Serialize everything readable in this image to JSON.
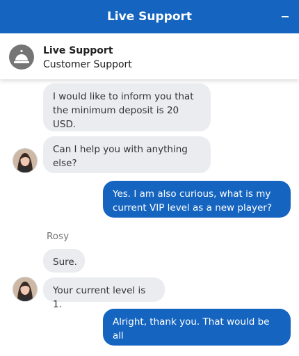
{
  "window": {
    "title": "Live Support",
    "minimize_icon": "minus-icon",
    "accent_color": "#1565c0"
  },
  "agent": {
    "name": "Live Support",
    "role": "Customer Support",
    "icon": "service-bell-icon"
  },
  "messages": [
    {
      "from": "agent",
      "text": "I would like to inform you that\nthe minimum deposit is 20\nUSD."
    },
    {
      "from": "agent",
      "text": "Can I help you with anything\nelse?"
    },
    {
      "from": "user",
      "text": "Yes. I am also curious, what is my\ncurrent VIP level as a new player?"
    },
    {
      "from": "agent",
      "sender": "Rosy",
      "text": "Sure."
    },
    {
      "from": "agent",
      "text": "Your current level is 1."
    },
    {
      "from": "user",
      "text": "Alright, thank you. That would be\nall"
    }
  ]
}
